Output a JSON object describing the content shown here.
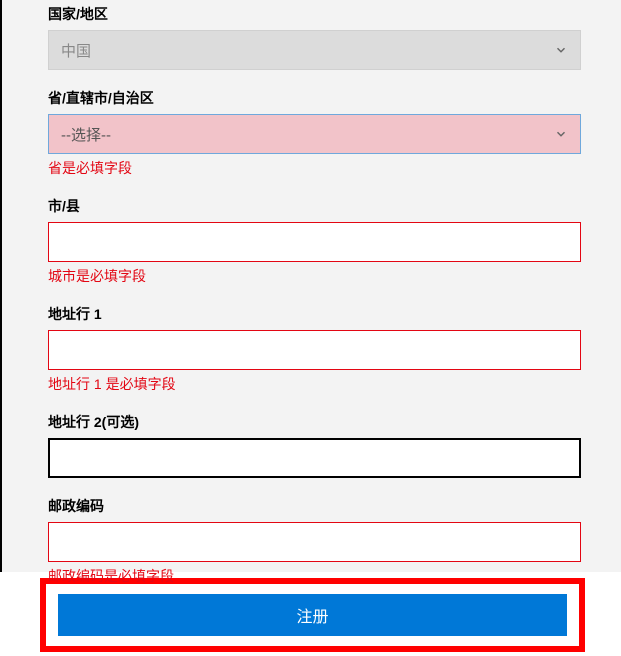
{
  "form": {
    "country": {
      "label": "国家/地区",
      "value": "中国"
    },
    "province": {
      "label": "省/直辖市/自治区",
      "placeholder": "--选择--",
      "error": "省是必填字段"
    },
    "city": {
      "label": "市/县",
      "value": "",
      "error": "城市是必填字段"
    },
    "address1": {
      "label": "地址行 1",
      "value": "",
      "error": "地址行 1 是必填字段"
    },
    "address2": {
      "label": "地址行 2(可选)",
      "value": ""
    },
    "postal": {
      "label": "邮政编码",
      "value": "",
      "error": "邮政编码是必填字段"
    }
  },
  "button": {
    "register": "注册"
  }
}
